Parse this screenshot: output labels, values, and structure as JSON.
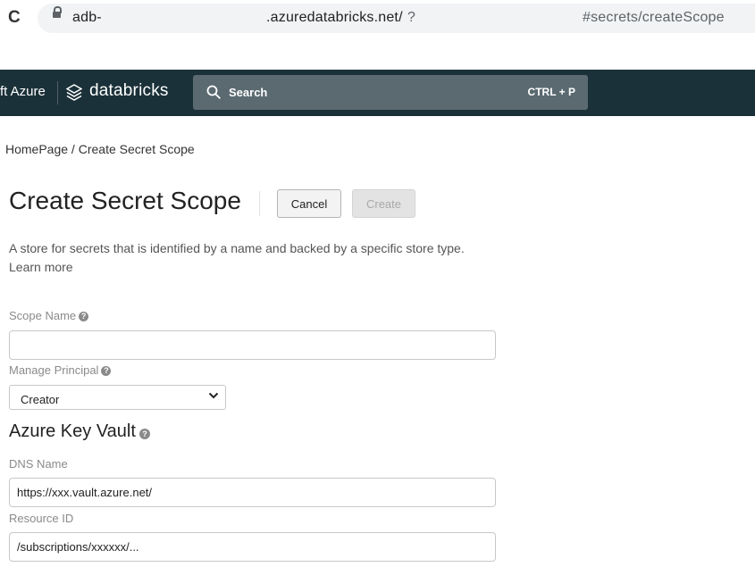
{
  "browser": {
    "url_host_prefix": "adb-",
    "url_host_suffix": ".azuredatabricks.net/",
    "url_query": "?",
    "url_fragment": "#secrets/createScope"
  },
  "header": {
    "brand_partial": "ft Azure",
    "brand_product": "databricks",
    "search_label": "Search",
    "search_shortcut": "CTRL + P"
  },
  "breadcrumb": {
    "home": "HomePage",
    "separator": " / ",
    "current": "Create Secret Scope"
  },
  "page": {
    "title": "Create Secret Scope",
    "cancel_label": "Cancel",
    "create_label": "Create",
    "description": "A store for secrets that is identified by a name and backed by a specific store type.",
    "learn_more": "Learn more"
  },
  "form": {
    "scope_name_label": "Scope Name",
    "scope_name_value": "",
    "manage_principal_label": "Manage Principal",
    "manage_principal_value": "Creator",
    "section_title": "Azure Key Vault",
    "dns_label": "DNS Name",
    "dns_value": "https://xxx.vault.azure.net/",
    "resource_label": "Resource ID",
    "resource_value": "/subscriptions/xxxxxx/..."
  },
  "colors": {
    "header_bg": "#1b3139",
    "search_bg": "#5b6a71"
  }
}
